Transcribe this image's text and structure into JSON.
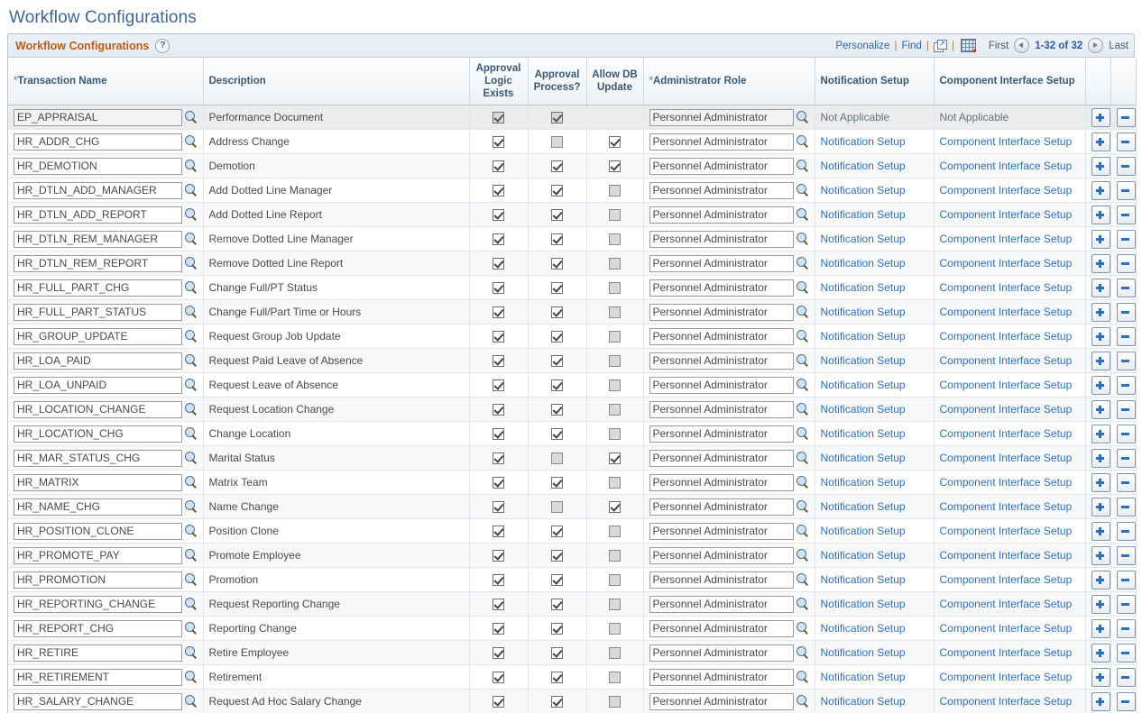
{
  "page": {
    "title": "Workflow Configurations"
  },
  "grid": {
    "title": "Workflow Configurations",
    "help_label": "?",
    "actions": {
      "personalize": "Personalize",
      "find": "Find",
      "expand_icon": "expand-icon",
      "download_icon": "download-to-excel-icon",
      "sep": "|"
    },
    "pager": {
      "first": "First",
      "prev_icon": "previous-arrow-icon",
      "range": "1-32 of 32",
      "next_icon": "next-arrow-icon",
      "last": "Last"
    },
    "columns": [
      {
        "label": "Transaction Name",
        "required": true
      },
      {
        "label": "Description",
        "required": false
      },
      {
        "label": "Approval Logic Exists",
        "required": false
      },
      {
        "label": "Approval Process?",
        "required": false
      },
      {
        "label": "Allow DB Update",
        "required": false
      },
      {
        "label": "Administrator Role",
        "required": true
      },
      {
        "label": "Notification Setup",
        "required": false
      },
      {
        "label": "Component Interface Setup",
        "required": false
      }
    ],
    "row_buttons": {
      "add": "+",
      "remove": "-"
    },
    "rows": [
      {
        "transaction_name": "EP_APPRAISAL",
        "description": "Performance Document",
        "approval_logic_exists": true,
        "approval_process": true,
        "allow_db_update": null,
        "administrator_role": "Personnel Administrator",
        "notification_setup": "Not Applicable",
        "notification_is_link": false,
        "component_interface_setup": "Not Applicable",
        "component_is_link": false,
        "disabled": true
      },
      {
        "transaction_name": "HR_ADDR_CHG",
        "description": "Address Change",
        "approval_logic_exists": true,
        "approval_process": false,
        "allow_db_update": true,
        "administrator_role": "Personnel Administrator",
        "notification_setup": "Notification Setup",
        "notification_is_link": true,
        "component_interface_setup": "Component Interface Setup",
        "component_is_link": true,
        "disabled": false
      },
      {
        "transaction_name": "HR_DEMOTION",
        "description": "Demotion",
        "approval_logic_exists": true,
        "approval_process": true,
        "allow_db_update": true,
        "administrator_role": "Personnel Administrator",
        "notification_setup": "Notification Setup",
        "notification_is_link": true,
        "component_interface_setup": "Component Interface Setup",
        "component_is_link": true,
        "disabled": false
      },
      {
        "transaction_name": "HR_DTLN_ADD_MANAGER",
        "description": "Add Dotted Line Manager",
        "approval_logic_exists": true,
        "approval_process": true,
        "allow_db_update": false,
        "administrator_role": "Personnel Administrator",
        "notification_setup": "Notification Setup",
        "notification_is_link": true,
        "component_interface_setup": "Component Interface Setup",
        "component_is_link": true,
        "disabled": false
      },
      {
        "transaction_name": "HR_DTLN_ADD_REPORT",
        "description": "Add Dotted Line Report",
        "approval_logic_exists": true,
        "approval_process": true,
        "allow_db_update": false,
        "administrator_role": "Personnel Administrator",
        "notification_setup": "Notification Setup",
        "notification_is_link": true,
        "component_interface_setup": "Component Interface Setup",
        "component_is_link": true,
        "disabled": false
      },
      {
        "transaction_name": "HR_DTLN_REM_MANAGER",
        "description": "Remove Dotted Line Manager",
        "approval_logic_exists": true,
        "approval_process": true,
        "allow_db_update": false,
        "administrator_role": "Personnel Administrator",
        "notification_setup": "Notification Setup",
        "notification_is_link": true,
        "component_interface_setup": "Component Interface Setup",
        "component_is_link": true,
        "disabled": false
      },
      {
        "transaction_name": "HR_DTLN_REM_REPORT",
        "description": "Remove Dotted Line Report",
        "approval_logic_exists": true,
        "approval_process": true,
        "allow_db_update": false,
        "administrator_role": "Personnel Administrator",
        "notification_setup": "Notification Setup",
        "notification_is_link": true,
        "component_interface_setup": "Component Interface Setup",
        "component_is_link": true,
        "disabled": false
      },
      {
        "transaction_name": "HR_FULL_PART_CHG",
        "description": "Change Full/PT Status",
        "approval_logic_exists": true,
        "approval_process": true,
        "allow_db_update": false,
        "administrator_role": "Personnel Administrator",
        "notification_setup": "Notification Setup",
        "notification_is_link": true,
        "component_interface_setup": "Component Interface Setup",
        "component_is_link": true,
        "disabled": false
      },
      {
        "transaction_name": "HR_FULL_PART_STATUS",
        "description": "Change Full/Part Time or Hours",
        "approval_logic_exists": true,
        "approval_process": true,
        "allow_db_update": false,
        "administrator_role": "Personnel Administrator",
        "notification_setup": "Notification Setup",
        "notification_is_link": true,
        "component_interface_setup": "Component Interface Setup",
        "component_is_link": true,
        "disabled": false
      },
      {
        "transaction_name": "HR_GROUP_UPDATE",
        "description": "Request Group Job Update",
        "approval_logic_exists": true,
        "approval_process": true,
        "allow_db_update": false,
        "administrator_role": "Personnel Administrator",
        "notification_setup": "Notification Setup",
        "notification_is_link": true,
        "component_interface_setup": "Component Interface Setup",
        "component_is_link": true,
        "disabled": false
      },
      {
        "transaction_name": "HR_LOA_PAID",
        "description": "Request Paid Leave of Absence",
        "approval_logic_exists": true,
        "approval_process": true,
        "allow_db_update": false,
        "administrator_role": "Personnel Administrator",
        "notification_setup": "Notification Setup",
        "notification_is_link": true,
        "component_interface_setup": "Component Interface Setup",
        "component_is_link": true,
        "disabled": false
      },
      {
        "transaction_name": "HR_LOA_UNPAID",
        "description": "Request Leave of Absence",
        "approval_logic_exists": true,
        "approval_process": true,
        "allow_db_update": false,
        "administrator_role": "Personnel Administrator",
        "notification_setup": "Notification Setup",
        "notification_is_link": true,
        "component_interface_setup": "Component Interface Setup",
        "component_is_link": true,
        "disabled": false
      },
      {
        "transaction_name": "HR_LOCATION_CHANGE",
        "description": "Request Location Change",
        "approval_logic_exists": true,
        "approval_process": true,
        "allow_db_update": false,
        "administrator_role": "Personnel Administrator",
        "notification_setup": "Notification Setup",
        "notification_is_link": true,
        "component_interface_setup": "Component Interface Setup",
        "component_is_link": true,
        "disabled": false
      },
      {
        "transaction_name": "HR_LOCATION_CHG",
        "description": "Change Location",
        "approval_logic_exists": true,
        "approval_process": true,
        "allow_db_update": false,
        "administrator_role": "Personnel Administrator",
        "notification_setup": "Notification Setup",
        "notification_is_link": true,
        "component_interface_setup": "Component Interface Setup",
        "component_is_link": true,
        "disabled": false
      },
      {
        "transaction_name": "HR_MAR_STATUS_CHG",
        "description": "Marital Status",
        "approval_logic_exists": true,
        "approval_process": false,
        "allow_db_update": true,
        "administrator_role": "Personnel Administrator",
        "notification_setup": "Notification Setup",
        "notification_is_link": true,
        "component_interface_setup": "Component Interface Setup",
        "component_is_link": true,
        "disabled": false
      },
      {
        "transaction_name": "HR_MATRIX",
        "description": "Matrix Team",
        "approval_logic_exists": true,
        "approval_process": true,
        "allow_db_update": false,
        "administrator_role": "Personnel Administrator",
        "notification_setup": "Notification Setup",
        "notification_is_link": true,
        "component_interface_setup": "Component Interface Setup",
        "component_is_link": true,
        "disabled": false
      },
      {
        "transaction_name": "HR_NAME_CHG",
        "description": "Name Change",
        "approval_logic_exists": true,
        "approval_process": false,
        "allow_db_update": true,
        "administrator_role": "Personnel Administrator",
        "notification_setup": "Notification Setup",
        "notification_is_link": true,
        "component_interface_setup": "Component Interface Setup",
        "component_is_link": true,
        "disabled": false
      },
      {
        "transaction_name": "HR_POSITION_CLONE",
        "description": "Position Clone",
        "approval_logic_exists": true,
        "approval_process": true,
        "allow_db_update": false,
        "administrator_role": "Personnel Administrator",
        "notification_setup": "Notification Setup",
        "notification_is_link": true,
        "component_interface_setup": "Component Interface Setup",
        "component_is_link": true,
        "disabled": false
      },
      {
        "transaction_name": "HR_PROMOTE_PAY",
        "description": "Promote Employee",
        "approval_logic_exists": true,
        "approval_process": true,
        "allow_db_update": false,
        "administrator_role": "Personnel Administrator",
        "notification_setup": "Notification Setup",
        "notification_is_link": true,
        "component_interface_setup": "Component Interface Setup",
        "component_is_link": true,
        "disabled": false
      },
      {
        "transaction_name": "HR_PROMOTION",
        "description": "Promotion",
        "approval_logic_exists": true,
        "approval_process": true,
        "allow_db_update": false,
        "administrator_role": "Personnel Administrator",
        "notification_setup": "Notification Setup",
        "notification_is_link": true,
        "component_interface_setup": "Component Interface Setup",
        "component_is_link": true,
        "disabled": false
      },
      {
        "transaction_name": "HR_REPORTING_CHANGE",
        "description": "Request Reporting Change",
        "approval_logic_exists": true,
        "approval_process": true,
        "allow_db_update": false,
        "administrator_role": "Personnel Administrator",
        "notification_setup": "Notification Setup",
        "notification_is_link": true,
        "component_interface_setup": "Component Interface Setup",
        "component_is_link": true,
        "disabled": false
      },
      {
        "transaction_name": "HR_REPORT_CHG",
        "description": "Reporting Change",
        "approval_logic_exists": true,
        "approval_process": true,
        "allow_db_update": false,
        "administrator_role": "Personnel Administrator",
        "notification_setup": "Notification Setup",
        "notification_is_link": true,
        "component_interface_setup": "Component Interface Setup",
        "component_is_link": true,
        "disabled": false
      },
      {
        "transaction_name": "HR_RETIRE",
        "description": "Retire Employee",
        "approval_logic_exists": true,
        "approval_process": true,
        "allow_db_update": false,
        "administrator_role": "Personnel Administrator",
        "notification_setup": "Notification Setup",
        "notification_is_link": true,
        "component_interface_setup": "Component Interface Setup",
        "component_is_link": true,
        "disabled": false
      },
      {
        "transaction_name": "HR_RETIREMENT",
        "description": "Retirement",
        "approval_logic_exists": true,
        "approval_process": true,
        "allow_db_update": false,
        "administrator_role": "Personnel Administrator",
        "notification_setup": "Notification Setup",
        "notification_is_link": true,
        "component_interface_setup": "Component Interface Setup",
        "component_is_link": true,
        "disabled": false
      },
      {
        "transaction_name": "HR_SALARY_CHANGE",
        "description": "Request Ad Hoc Salary Change",
        "approval_logic_exists": true,
        "approval_process": true,
        "allow_db_update": false,
        "administrator_role": "Personnel Administrator",
        "notification_setup": "Notification Setup",
        "notification_is_link": true,
        "component_interface_setup": "Component Interface Setup",
        "component_is_link": true,
        "disabled": false
      }
    ]
  }
}
